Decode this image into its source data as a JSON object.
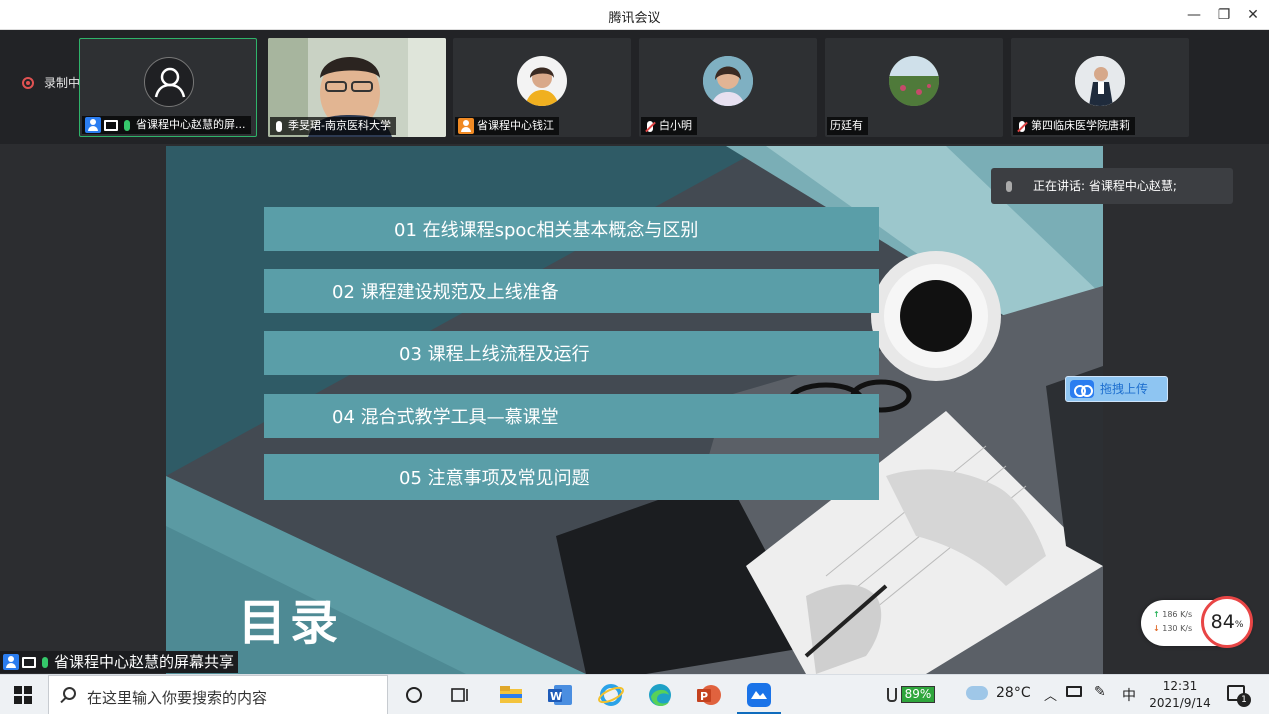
{
  "window": {
    "title": "腾讯会议",
    "minimize_icon": "minimize-icon",
    "restore_icon": "restore-icon",
    "close_icon": "close-icon"
  },
  "recording": {
    "label": "录制中"
  },
  "participants": [
    {
      "name": "省课程中心赵慧的屏...",
      "avatar": "user-outline",
      "active": true,
      "share": true,
      "mic": "on",
      "role_icon": "user-blue"
    },
    {
      "name": "季旻珺-南京医科大学",
      "avatar": "video",
      "mic": "on"
    },
    {
      "name": "省课程中心钱江",
      "avatar": "photo-woman",
      "role_icon": "user-orange"
    },
    {
      "name": "白小明",
      "avatar": "photo-woman",
      "mic": "muted"
    },
    {
      "name": "历廷有",
      "avatar": "photo-landscape"
    },
    {
      "name": "第四临床医学院唐莉",
      "avatar": "photo-man",
      "mic": "muted"
    }
  ],
  "speaking": {
    "label": "正在讲话: 省课程中心赵慧;"
  },
  "slide": {
    "title": "目录",
    "items": [
      "01  在线课程spoc相关基本概念与区别",
      "02  课程建设规范及上线准备",
      "03    课程上线流程及运行",
      "04  混合式教学工具—慕课堂",
      "05    注意事项及常见问题"
    ]
  },
  "upload_button": {
    "label": "拖拽上传"
  },
  "network": {
    "up": "186 K/s",
    "down": "130 K/s",
    "value": "84",
    "unit": "%"
  },
  "share_label": "省课程中心赵慧的屏幕共享",
  "taskbar": {
    "search_placeholder": "在这里输入你要搜索的内容",
    "battery": "89%",
    "weather": "28°C",
    "ime": "中",
    "time": "12:31",
    "date": "2021/9/14",
    "notifications": "1"
  }
}
